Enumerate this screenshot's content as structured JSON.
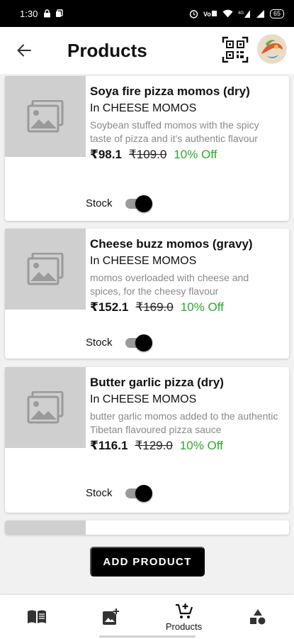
{
  "status_bar": {
    "time": "1:30",
    "battery": "65"
  },
  "app_bar": {
    "title": "Products"
  },
  "products": [
    {
      "name": "Soya fire pizza momos (dry)",
      "category": "In CHEESE MOMOS",
      "description": "Soybean stuffed momos with the spicy taste of pizza and it's authentic flavour",
      "price": "₹98.1",
      "mrp": "₹109.0",
      "discount": "10% Off",
      "stock_label": "Stock",
      "in_stock": true
    },
    {
      "name": "Cheese buzz momos (gravy)",
      "category": "In CHEESE MOMOS",
      "description": "momos overloaded with cheese and spices, for the cheesy flavour",
      "price": "₹152.1",
      "mrp": "₹169.0",
      "discount": "10% Off",
      "stock_label": "Stock",
      "in_stock": true
    },
    {
      "name": "Butter garlic pizza (dry)",
      "category": "In CHEESE MOMOS",
      "description": "butter garlic momos added to the authentic Tibetan flavoured pizza sauce",
      "price": "₹116.1",
      "mrp": "₹129.0",
      "discount": "10% Off",
      "stock_label": "Stock",
      "in_stock": true
    }
  ],
  "add_product_button": "ADD PRODUCT",
  "bottom_nav": [
    {
      "icon": "menu-book-icon",
      "label": ""
    },
    {
      "icon": "add-photo-icon",
      "label": ""
    },
    {
      "icon": "add-cart-icon",
      "label": "Products",
      "active": true
    },
    {
      "icon": "category-shapes-icon",
      "label": ""
    }
  ],
  "colors": {
    "discount_green": "#2ea82e",
    "primary": "#000000",
    "placeholder_bg": "#cfcfcf"
  }
}
